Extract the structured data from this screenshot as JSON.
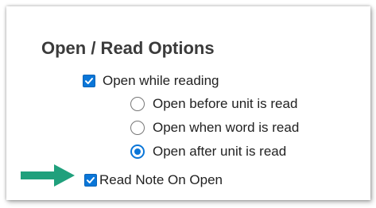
{
  "panel": {
    "title": "Open / Read Options",
    "open_while_reading": {
      "label": "Open while reading",
      "checked": true
    },
    "radio_options": [
      {
        "label": "Open before unit is read",
        "checked": false
      },
      {
        "label": "Open when word is read",
        "checked": false
      },
      {
        "label": "Open after unit is read",
        "checked": true
      }
    ],
    "read_note_on_open": {
      "label": "Read Note On Open",
      "checked": true
    }
  },
  "colors": {
    "accent": "#0a76d8",
    "arrow": "#20a07c"
  },
  "icons": {
    "check": "checkmark-icon",
    "annotation": "arrow-right-icon"
  }
}
